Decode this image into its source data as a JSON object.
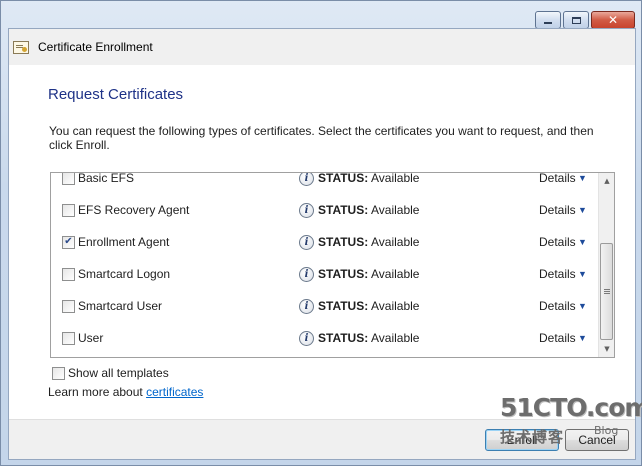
{
  "window": {
    "title": "Certificate Enrollment",
    "minimize_icon": "minimize-icon",
    "maximize_icon": "maximize-icon",
    "close_glyph": "✕"
  },
  "page": {
    "heading": "Request Certificates",
    "intro": "You can request the following types of certificates. Select the certificates you want to request, and then click Enroll."
  },
  "certificates": [
    {
      "name": "Basic EFS",
      "checked": false,
      "status_label": "STATUS:",
      "status": "Available",
      "details": "Details"
    },
    {
      "name": "EFS Recovery Agent",
      "checked": false,
      "status_label": "STATUS:",
      "status": "Available",
      "details": "Details"
    },
    {
      "name": "Enrollment Agent",
      "checked": true,
      "status_label": "STATUS:",
      "status": "Available",
      "details": "Details"
    },
    {
      "name": "Smartcard Logon",
      "checked": false,
      "status_label": "STATUS:",
      "status": "Available",
      "details": "Details"
    },
    {
      "name": "Smartcard User",
      "checked": false,
      "status_label": "STATUS:",
      "status": "Available",
      "details": "Details"
    },
    {
      "name": "User",
      "checked": false,
      "status_label": "STATUS:",
      "status": "Available",
      "details": "Details"
    }
  ],
  "options": {
    "show_all_templates": "Show all templates",
    "show_all_checked": false
  },
  "learn_more": {
    "prefix": "Learn more about ",
    "link": "certificates"
  },
  "buttons": {
    "enroll": "Enroll",
    "cancel": "Cancel"
  },
  "watermark": {
    "main": "51CTO.com",
    "sub": "技术博客",
    "blog": "Blog"
  },
  "colors": {
    "heading": "#1e3287",
    "link": "#0066cc"
  }
}
